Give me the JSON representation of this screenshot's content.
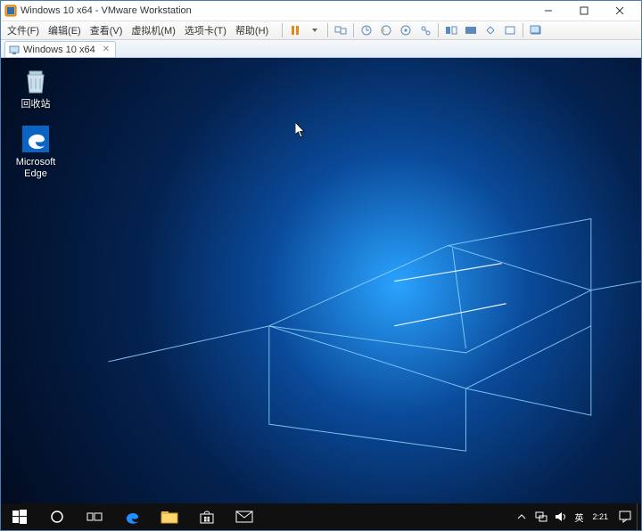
{
  "window": {
    "title": "Windows 10 x64 - VMware Workstation"
  },
  "menubar": {
    "file": "文件(F)",
    "edit": "编辑(E)",
    "view": "查看(V)",
    "vm": "虚拟机(M)",
    "tabs": "选项卡(T)",
    "help": "帮助(H)"
  },
  "tabs": {
    "active": {
      "label": "Windows 10 x64"
    }
  },
  "desktop": {
    "icons": [
      {
        "label": "回收站"
      },
      {
        "label": "Microsoft Edge"
      }
    ]
  },
  "systray": {
    "ime": "英",
    "time": "2:21"
  }
}
